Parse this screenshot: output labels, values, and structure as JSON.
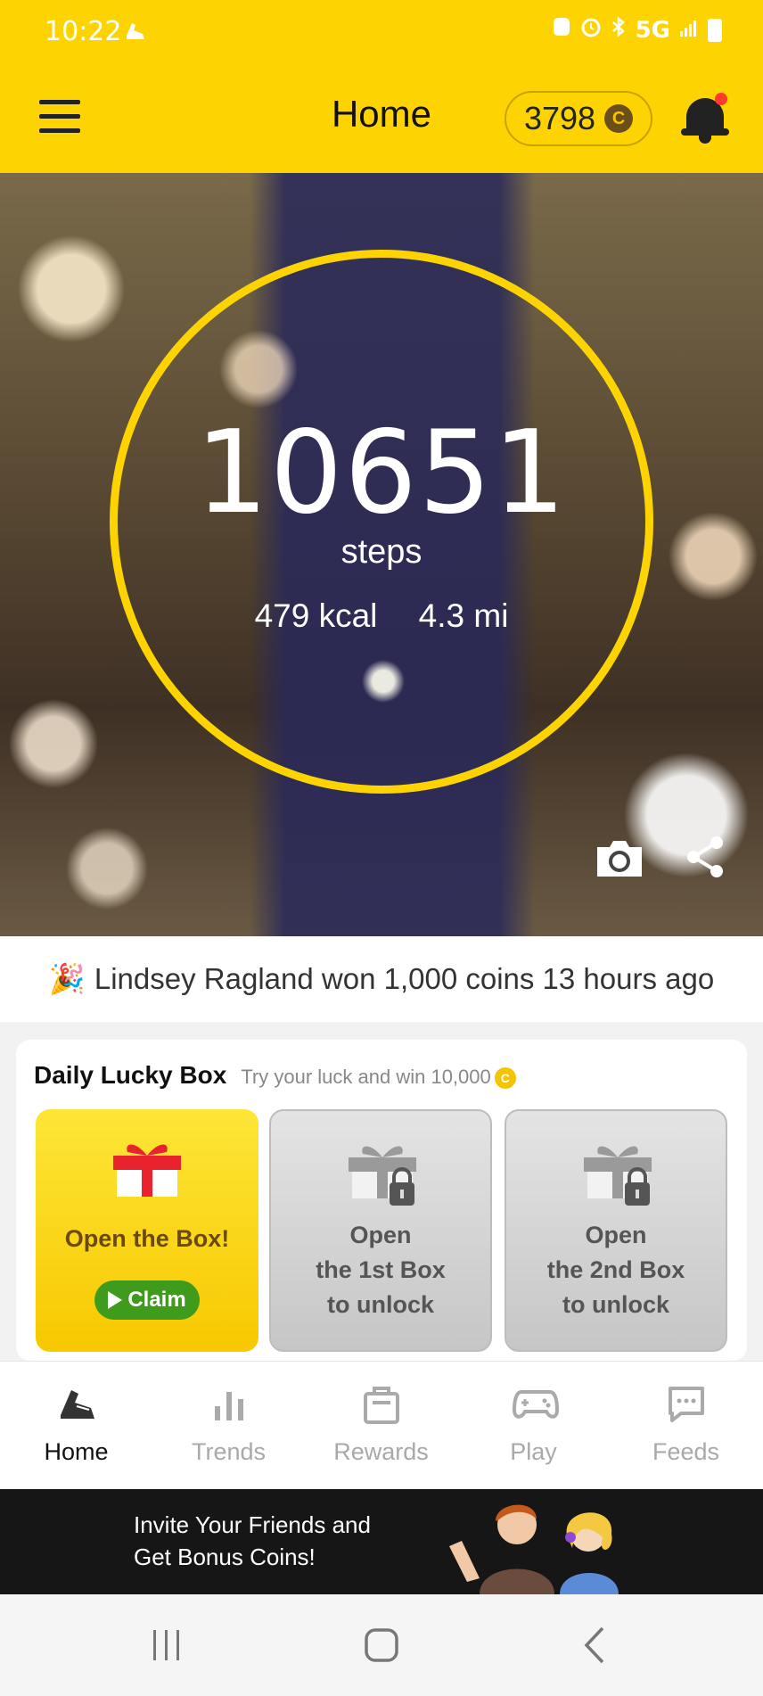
{
  "status_bar": {
    "time": "10:22",
    "network": "5G"
  },
  "header": {
    "title": "Home",
    "coins": "3798",
    "coin_symbol": "C"
  },
  "hero": {
    "steps": "10651",
    "steps_label": "steps",
    "kcal": "479 kcal",
    "distance": "4.3 mi"
  },
  "ticker": {
    "emoji": "🎉",
    "text": "Lindsey Ragland won 1,000 coins 13 hours ago"
  },
  "lucky_box": {
    "title": "Daily Lucky Box",
    "subtitle": "Try your luck and win 10,000",
    "coin_symbol": "C",
    "boxes": [
      {
        "label": "Open the Box!",
        "button": "Claim"
      },
      {
        "line1": "Open",
        "line2": "the 1st Box",
        "line3": "to unlock"
      },
      {
        "line1": "Open",
        "line2": "the 2nd Box",
        "line3": "to unlock"
      }
    ]
  },
  "nav": {
    "tabs": [
      {
        "label": "Home"
      },
      {
        "label": "Trends"
      },
      {
        "label": "Rewards"
      },
      {
        "label": "Play"
      },
      {
        "label": "Feeds"
      }
    ]
  },
  "promo": {
    "line1": "Invite Your Friends and",
    "line2": "Get Bonus Coins!"
  },
  "colors": {
    "brand_yellow": "#fdd402",
    "claim_green": "#3f9b1c",
    "notification_red": "#ff3b2f"
  }
}
